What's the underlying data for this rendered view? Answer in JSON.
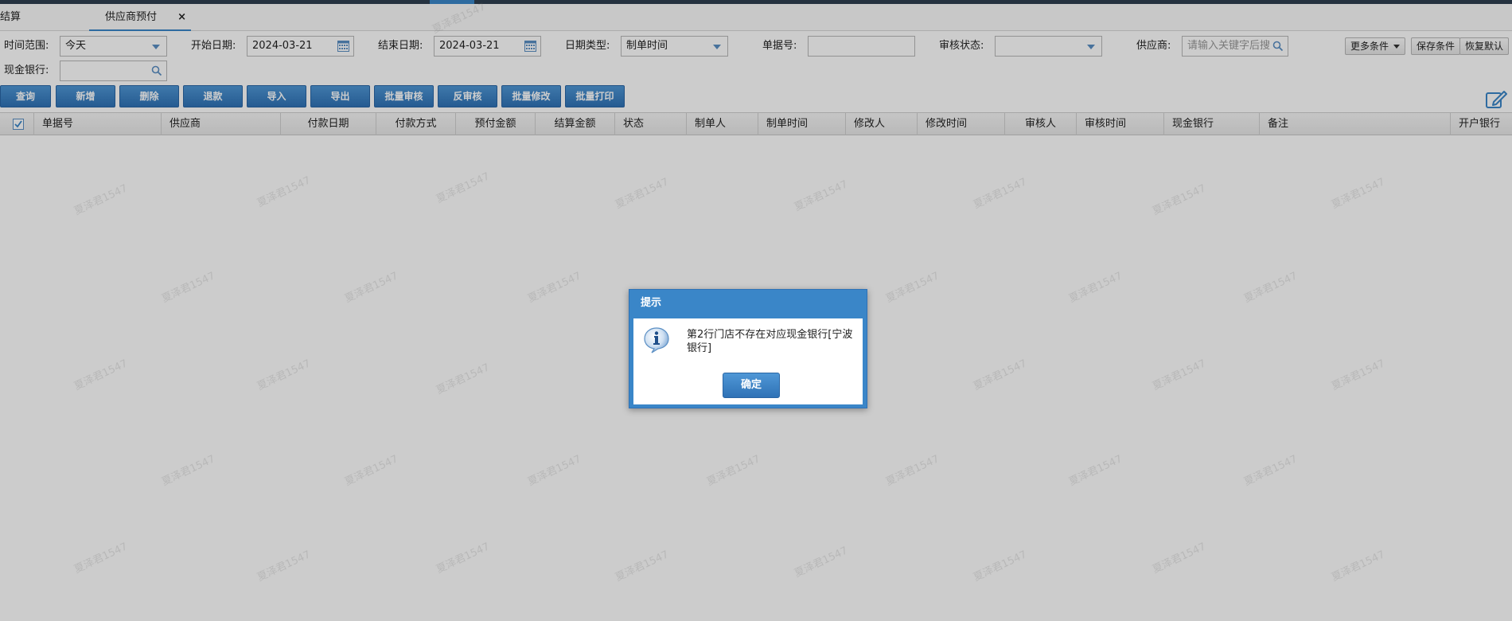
{
  "tabs": {
    "settle": "结算",
    "active": "供应商预付",
    "close": "×"
  },
  "filters": {
    "time_range_label": "时间范围:",
    "time_range_value": "今天",
    "start_date_label": "开始日期:",
    "start_date_value": "2024-03-21",
    "end_date_label": "结束日期:",
    "end_date_value": "2024-03-21",
    "date_type_label": "日期类型:",
    "date_type_value": "制单时间",
    "doc_no_label": "单据号:",
    "doc_no_value": "",
    "audit_status_label": "审核状态:",
    "audit_status_value": "",
    "supplier_label": "供应商:",
    "supplier_placeholder": "请输入关键字后搜",
    "cash_bank_label": "现金银行:",
    "cash_bank_value": ""
  },
  "side_buttons": {
    "more": "更多条件",
    "save": "保存条件",
    "restore": "恢复默认"
  },
  "actions": [
    "查询",
    "新增",
    "删除",
    "退款",
    "导入",
    "导出",
    "批量审核",
    "反审核",
    "批量修改",
    "批量打印"
  ],
  "columns": [
    "单据号",
    "供应商",
    "付款日期",
    "付款方式",
    "预付金额",
    "结算金额",
    "状态",
    "制单人",
    "制单时间",
    "修改人",
    "修改时间",
    "审核人",
    "审核时间",
    "现金银行",
    "备注",
    "开户银行"
  ],
  "watermark": "夏泽君1547",
  "dialog": {
    "title": "提示",
    "message": "第2行门店不存在对应现金银行[宁波银行]",
    "ok": "确定"
  },
  "colors": {
    "accent": "#3a86c8",
    "button": "#2f72b6"
  }
}
